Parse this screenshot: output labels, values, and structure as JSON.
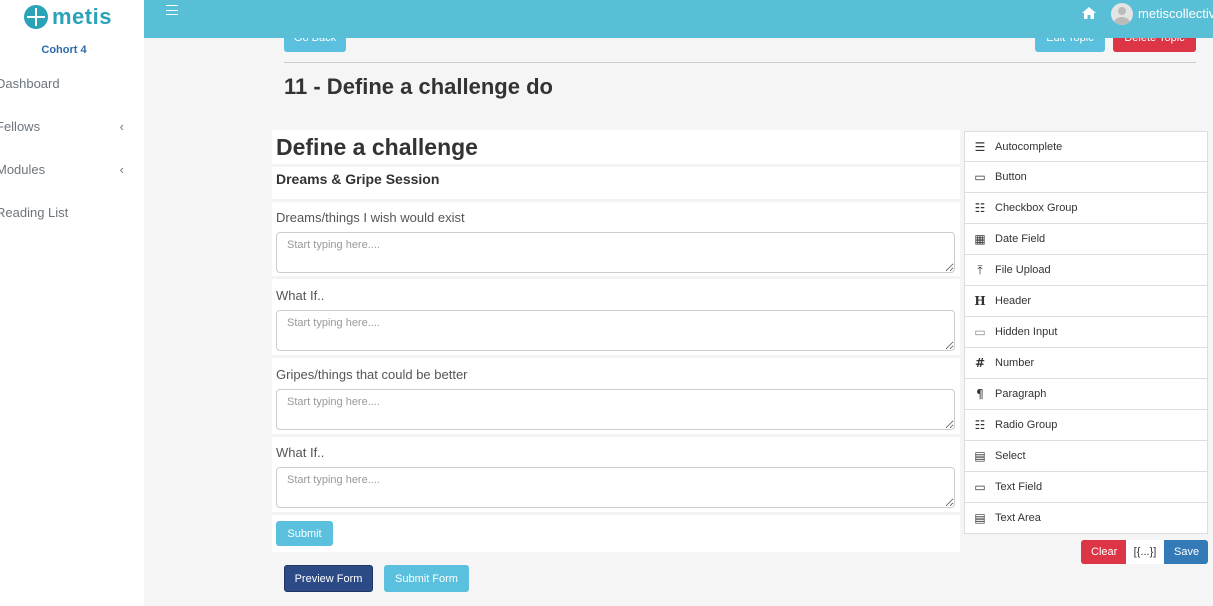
{
  "brand": {
    "name": "metis",
    "cohort": "Cohort 4"
  },
  "sidebar": {
    "items": [
      {
        "label": "Dashboard"
      },
      {
        "label": "Fellows"
      },
      {
        "label": "Modules"
      },
      {
        "label": "Reading List"
      }
    ]
  },
  "topbar": {
    "user_name": "metiscollective"
  },
  "header": {
    "go_back": "Go Back",
    "edit_topic": "Edit Topic",
    "delete_topic": "Delete Topic",
    "title": "11 - Define a challenge do"
  },
  "form": {
    "heading": "Define a challenge",
    "subheading": "Dreams & Gripe Session",
    "fields": [
      {
        "label": "Dreams/things I wish would exist",
        "placeholder": "Start typing here...."
      },
      {
        "label": "What If..",
        "placeholder": "Start typing here...."
      },
      {
        "label": "Gripes/things that could be better",
        "placeholder": "Start typing here...."
      },
      {
        "label": "What If..",
        "placeholder": "Start typing here...."
      }
    ],
    "submit_label": "Submit"
  },
  "controls": {
    "items": [
      {
        "label": "Autocomplete",
        "icon": "autocomplete-icon"
      },
      {
        "label": "Button",
        "icon": "button-icon"
      },
      {
        "label": "Checkbox Group",
        "icon": "checkbox-group-icon"
      },
      {
        "label": "Date Field",
        "icon": "calendar-icon"
      },
      {
        "label": "File Upload",
        "icon": "upload-icon"
      },
      {
        "label": "Header",
        "icon": "header-icon"
      },
      {
        "label": "Hidden Input",
        "icon": "hidden-input-icon"
      },
      {
        "label": "Number",
        "icon": "hash-icon"
      },
      {
        "label": "Paragraph",
        "icon": "paragraph-icon"
      },
      {
        "label": "Radio Group",
        "icon": "radio-group-icon"
      },
      {
        "label": "Select",
        "icon": "select-icon"
      },
      {
        "label": "Text Field",
        "icon": "text-field-icon"
      },
      {
        "label": "Text Area",
        "icon": "text-area-icon"
      }
    ],
    "clear": "Clear",
    "data": "[{...}]",
    "save": "Save"
  },
  "footer": {
    "preview": "Preview Form",
    "submit": "Submit Form"
  },
  "colors": {
    "topbar": "#58bfd6",
    "brand": "#2aa3b9",
    "danger": "#dc3545",
    "info": "#5bc0de",
    "primary": "#337ab7",
    "dark_primary": "#2c4a85"
  }
}
